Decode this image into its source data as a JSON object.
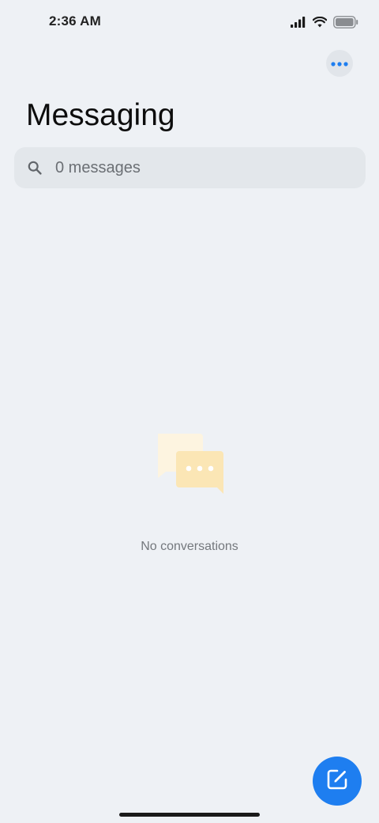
{
  "status_bar": {
    "time": "2:36 AM",
    "icons": [
      "signal-icon",
      "wifi-icon",
      "battery-icon"
    ]
  },
  "header": {
    "title": "Messaging",
    "more_icon": "more-horizontal-icon"
  },
  "search": {
    "placeholder": "0 messages",
    "value": "",
    "icon": "search-icon"
  },
  "empty_state": {
    "illustration": "chat-bubbles-icon",
    "text": "No conversations"
  },
  "fab": {
    "icon": "compose-icon"
  },
  "colors": {
    "background": "#eef1f5",
    "accent": "#1e7ef0",
    "search_bg": "#e3e7eb",
    "empty_text": "#74787d"
  }
}
